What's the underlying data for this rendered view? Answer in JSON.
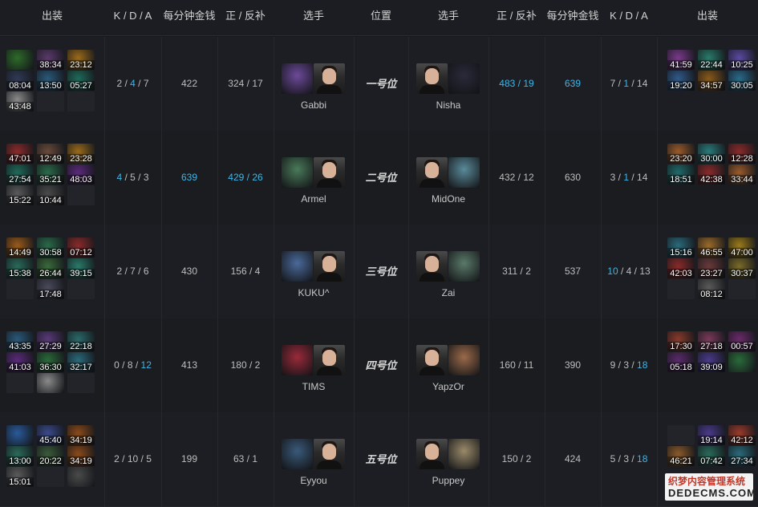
{
  "header": {
    "left_items": "出装",
    "left_kda": "K / D / A",
    "left_gpm": "每分钟金钱",
    "left_lh": "正 / 反补",
    "left_player": "选手",
    "position": "位置",
    "right_player": "选手",
    "right_lh": "正 / 反补",
    "right_gpm": "每分钟金钱",
    "right_kda": "K / D / A",
    "right_items": "出装"
  },
  "colors": {
    "highlight": "#3fb6e8",
    "background": "#15171b",
    "text": "#c9c9c9"
  },
  "rows": [
    {
      "position": "一号位",
      "left": {
        "player": "Gabbi",
        "kda": {
          "k": "2",
          "d": "4",
          "a": "7"
        },
        "gpm": "422",
        "lh": {
          "last": "324",
          "deny": "17"
        },
        "items": [
          "",
          "38:34",
          "23:12",
          "08:04",
          "13:50",
          "05:27",
          "43:48",
          "",
          ""
        ],
        "item_colors": [
          "#2e6b2a",
          "#5a3a6a",
          "#9a6a1a",
          "#303a55",
          "#2a5a7a",
          "#1f6a5a",
          "#8a8a8a",
          "",
          ""
        ],
        "hero_color": "#6d4a9a"
      },
      "right": {
        "player": "Nisha",
        "kda": {
          "k": "7",
          "d": "1",
          "a": "14"
        },
        "gpm": "639",
        "lh": {
          "last": "483",
          "deny": "19"
        },
        "items": [
          "41:59",
          "22:44",
          "10:25",
          "19:20",
          "34:57",
          "30:05"
        ],
        "item_colors": [
          "#7a3a8a",
          "#2a7a6a",
          "#5a4aa0",
          "#305a8a",
          "#8a5a1a",
          "#2a6a8a"
        ],
        "hero_color": "#2a2a3a"
      }
    },
    {
      "position": "二号位",
      "left": {
        "player": "Armel",
        "kda": {
          "k": "4",
          "d": "5",
          "a": "3"
        },
        "gpm": "639",
        "lh": {
          "last": "429",
          "deny": "26"
        },
        "items": [
          "47:01",
          "12:49",
          "23:28",
          "27:54",
          "35:21",
          "48:03",
          "15:22",
          "10:44",
          ""
        ],
        "item_colors": [
          "#8a2a2a",
          "#6a4a3a",
          "#9a6a1a",
          "#1f6a5a",
          "#2a6a4a",
          "#5a2a7a",
          "#5a5a5a",
          "#4a4a4a",
          ""
        ],
        "hero_color": "#4a7a5a"
      },
      "right": {
        "player": "MidOne",
        "kda": {
          "k": "3",
          "d": "1",
          "a": "14"
        },
        "gpm": "630",
        "lh": {
          "last": "432",
          "deny": "12"
        },
        "items": [
          "23:20",
          "30:00",
          "12:28",
          "18:51",
          "42:38",
          "33:44"
        ],
        "item_colors": [
          "#9a5a2a",
          "#2a7a7a",
          "#8a2a2a",
          "#1f6a6a",
          "#8a2a2a",
          "#9a5a2a"
        ],
        "hero_color": "#5a8a9a"
      }
    },
    {
      "position": "三号位",
      "left": {
        "player": "KUKU^",
        "kda": {
          "k": "2",
          "d": "7",
          "a": "6"
        },
        "gpm": "430",
        "lh": {
          "last": "156",
          "deny": "4"
        },
        "items": [
          "14:49",
          "30:58",
          "07:12",
          "15:38",
          "26:44",
          "39:15",
          "",
          "17:48",
          ""
        ],
        "item_colors": [
          "#9a5a1a",
          "#2a6a4a",
          "#8a2a2a",
          "#2a6a5a",
          "#3a6a3a",
          "#2a7a6a",
          "",
          "#4a4a5a",
          ""
        ],
        "hero_color": "#4a6a9a"
      },
      "right": {
        "player": "Zai",
        "kda": {
          "k": "10",
          "d": "4",
          "a": "13"
        },
        "gpm": "537",
        "lh": {
          "last": "311",
          "deny": "2"
        },
        "items": [
          "15:16",
          "46:55",
          "47:00",
          "42:03",
          "23:27",
          "30:37",
          "",
          "08:12",
          ""
        ],
        "item_colors": [
          "#2a6a7a",
          "#9a6a2a",
          "#9a7a1a",
          "#8a2a2a",
          "#6a3a3a",
          "#7a6a2a",
          "",
          "#5a5a5a",
          ""
        ],
        "hero_color": "#5a7a6a"
      }
    },
    {
      "position": "四号位",
      "left": {
        "player": "TIMS",
        "kda": {
          "k": "0",
          "d": "8",
          "a": "12"
        },
        "gpm": "413",
        "lh": {
          "last": "180",
          "deny": "2"
        },
        "items": [
          "43:35",
          "27:29",
          "22:18",
          "41:03",
          "36:30",
          "32:17",
          "",
          "",
          ""
        ],
        "item_colors": [
          "#2a5a7a",
          "#5a3a7a",
          "#2a6a6a",
          "#5a2a7a",
          "#2a6a3a",
          "#2a6a7a",
          "",
          "#8a8a8a",
          ""
        ],
        "hero_color": "#9a2a3a"
      },
      "right": {
        "player": "YapzOr",
        "kda": {
          "k": "9",
          "d": "3",
          "a": "18"
        },
        "gpm": "390",
        "lh": {
          "last": "160",
          "deny": "11"
        },
        "items": [
          "17:30",
          "27:18",
          "00:57",
          "05:18",
          "39:09",
          ""
        ],
        "item_colors": [
          "#8a3a2a",
          "#7a3a5a",
          "#6a2a6a",
          "#5a2a6a",
          "#4a3a8a",
          "#2a6a3a"
        ],
        "hero_color": "#9a6a4a"
      }
    },
    {
      "position": "五号位",
      "left": {
        "player": "Eyyou",
        "kda": {
          "k": "2",
          "d": "10",
          "a": "5"
        },
        "gpm": "199",
        "lh": {
          "last": "63",
          "deny": "1"
        },
        "items": [
          "",
          "45:40",
          "34:19",
          "13:00",
          "20:22",
          "34:19",
          "15:01",
          "",
          ""
        ],
        "item_colors": [
          "#2a5a9a",
          "#3a4a8a",
          "#8a4a1a",
          "#2a6a5a",
          "#3a5a3a",
          "#8a4a1a",
          "#5a5a5a",
          "",
          "#4a4a4a"
        ],
        "hero_color": "#3a5a7a"
      },
      "right": {
        "player": "Puppey",
        "kda": {
          "k": "5",
          "d": "3",
          "a": "18"
        },
        "gpm": "424",
        "lh": {
          "last": "150",
          "deny": "2"
        },
        "items": [
          "",
          "19:14",
          "42:12",
          "46:21",
          "07:42",
          "27:34"
        ],
        "item_colors": [
          "",
          "#4a3a8a",
          "#9a3a2a",
          "#8a5a2a",
          "#2a6a5a",
          "#2a6a7a"
        ],
        "hero_color": "#9a8a6a"
      }
    }
  ],
  "watermark": {
    "line1": "织梦内容管理系统",
    "line2": "DEDECMS.COM"
  }
}
